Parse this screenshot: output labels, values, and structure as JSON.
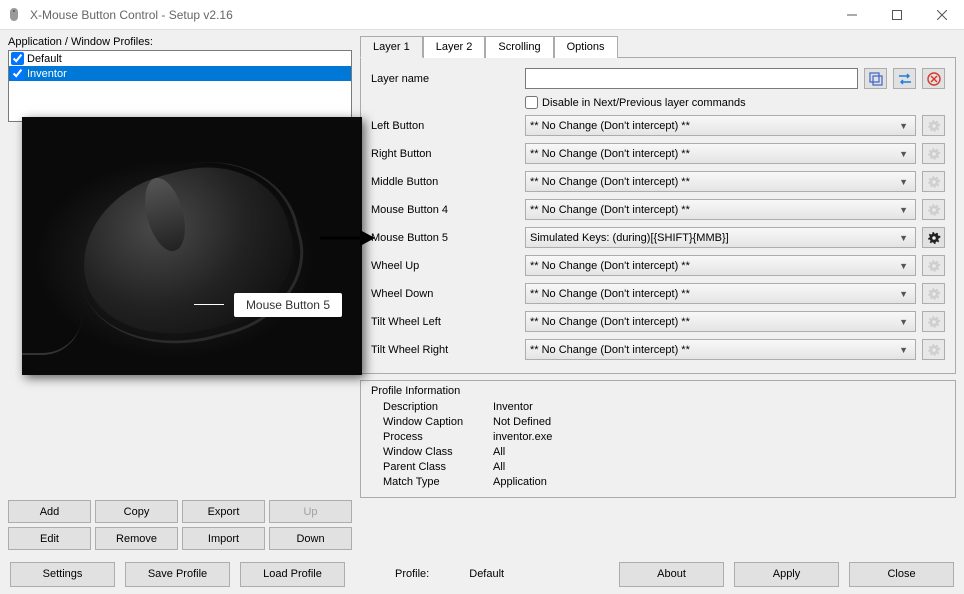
{
  "window": {
    "title": "X-Mouse Button Control - Setup v2.16",
    "min_tooltip": "Minimize",
    "max_tooltip": "Maximize",
    "close_tooltip": "Close"
  },
  "left": {
    "profiles_label": "Application / Window Profiles:",
    "profiles": [
      {
        "name": "Default",
        "checked": true,
        "selected": false
      },
      {
        "name": "Inventor",
        "checked": true,
        "selected": true
      }
    ],
    "mouse_callout": "Mouse Button 5",
    "buttons": {
      "add": "Add",
      "copy": "Copy",
      "export": "Export",
      "up": "Up",
      "edit": "Edit",
      "remove": "Remove",
      "import": "Import",
      "down": "Down"
    }
  },
  "tabs": {
    "items": [
      "Layer 1",
      "Layer 2",
      "Scrolling",
      "Options"
    ],
    "active_index": 0
  },
  "layer": {
    "name_label": "Layer name",
    "name_value": "",
    "disable_label": "Disable in Next/Previous layer commands",
    "no_change": "** No Change (Don't intercept) **",
    "rows": [
      {
        "label": "Left Button",
        "value": "** No Change (Don't intercept) **",
        "gear_enabled": false
      },
      {
        "label": "Right Button",
        "value": "** No Change (Don't intercept) **",
        "gear_enabled": false
      },
      {
        "label": "Middle Button",
        "value": "** No Change (Don't intercept) **",
        "gear_enabled": false
      },
      {
        "label": "Mouse Button 4",
        "value": "** No Change (Don't intercept) **",
        "gear_enabled": false
      },
      {
        "label": "Mouse Button 5",
        "value": "Simulated Keys: (during)[{SHIFT}{MMB}]",
        "gear_enabled": true
      },
      {
        "label": "Wheel Up",
        "value": "** No Change (Don't intercept) **",
        "gear_enabled": false
      },
      {
        "label": "Wheel Down",
        "value": "** No Change (Don't intercept) **",
        "gear_enabled": false
      },
      {
        "label": "Tilt Wheel Left",
        "value": "** No Change (Don't intercept) **",
        "gear_enabled": false
      },
      {
        "label": "Tilt Wheel Right",
        "value": "** No Change (Don't intercept) **",
        "gear_enabled": false
      }
    ]
  },
  "profile_info": {
    "title": "Profile Information",
    "rows": [
      {
        "label": "Description",
        "value": "Inventor"
      },
      {
        "label": "Window Caption",
        "value": "Not Defined"
      },
      {
        "label": "Process",
        "value": "inventor.exe"
      },
      {
        "label": "Window Class",
        "value": "All"
      },
      {
        "label": "Parent Class",
        "value": "All"
      },
      {
        "label": "Match Type",
        "value": "Application"
      }
    ]
  },
  "bottom": {
    "settings": "Settings",
    "save_profile": "Save Profile",
    "load_profile": "Load Profile",
    "profile_label": "Profile:",
    "profile_value": "Default",
    "about": "About",
    "apply": "Apply",
    "close": "Close"
  }
}
